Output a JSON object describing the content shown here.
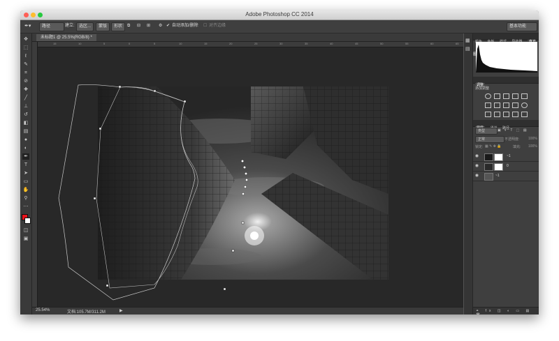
{
  "window": {
    "title": "Adobe Photoshop CC 2014"
  },
  "options_bar": {
    "path_mode": "路径",
    "make_label": "建立:",
    "selection_btn": "选区...",
    "mask_btn": "蒙版",
    "shape_btn": "形状",
    "auto_add_delete": "自动添加/删除",
    "align_edges": "对齐边缘",
    "workspace": "基本功能"
  },
  "document": {
    "tab_title": "未标题1 @ 25.5%(RGB/8) *",
    "ruler_ticks": [
      "15",
      "10",
      "5",
      "0",
      "5",
      "10",
      "15",
      "20",
      "25",
      "30",
      "35",
      "40",
      "45",
      "50",
      "55",
      "60",
      "65"
    ],
    "zoom": "25.54%",
    "doc_info": "文档:105.7M/311.2M"
  },
  "panels": {
    "histogram_tabs": [
      "颜色",
      "色板",
      "样式",
      "导航器",
      "直方图"
    ],
    "adjustments_tab": "调整",
    "add_adjustment": "添加调整",
    "layers_tabs": [
      "图层",
      "通道",
      "路径"
    ],
    "kind_filter": "类型",
    "blend_mode": "正常",
    "opacity_label": "不透明度:",
    "opacity_value": "100%",
    "lock_label": "锁定:",
    "fill_label": "填充:",
    "fill_value": "100%",
    "layers": [
      {
        "name": "~1"
      },
      {
        "name": "0"
      },
      {
        "name": "~1"
      }
    ]
  },
  "colors": {
    "foreground": "#e8121b",
    "background": "#ffffff"
  }
}
